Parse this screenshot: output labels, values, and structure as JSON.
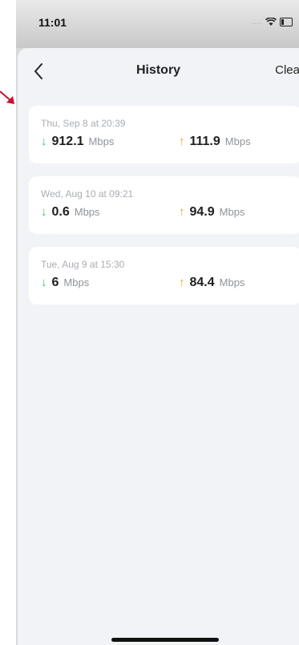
{
  "status_bar": {
    "time": "11:01"
  },
  "nav": {
    "title": "History",
    "clear_label": "Clear",
    "back_icon": "chevron-left-icon"
  },
  "colors": {
    "download_arrow": "#33c26a",
    "upload_arrow": "#f6a11a",
    "annotation_arrow": "#c8102e"
  },
  "history": [
    {
      "date": "Thu, Sep 8 at 20:39",
      "download": "912.1",
      "download_unit": "Mbps",
      "upload": "111.9",
      "upload_unit": "Mbps"
    },
    {
      "date": "Wed, Aug 10 at 09:21",
      "download": "0.6",
      "download_unit": "Mbps",
      "upload": "94.9",
      "upload_unit": "Mbps"
    },
    {
      "date": "Tue, Aug 9 at 15:30",
      "download": "6",
      "download_unit": "Mbps",
      "upload": "84.4",
      "upload_unit": "Mbps"
    }
  ],
  "icons": {
    "download": "arrow-down-icon",
    "upload": "arrow-up-icon",
    "wifi": "wifi-icon",
    "battery": "battery-icon"
  }
}
